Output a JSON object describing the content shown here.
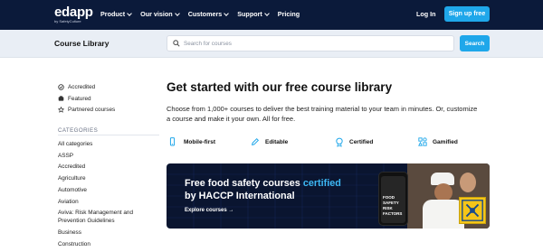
{
  "nav": {
    "logo": "edapp",
    "logo_sub": "by SafetyCulture",
    "items": [
      {
        "label": "Product",
        "dropdown": true
      },
      {
        "label": "Our vision",
        "dropdown": true
      },
      {
        "label": "Customers",
        "dropdown": true
      },
      {
        "label": "Support",
        "dropdown": true
      },
      {
        "label": "Pricing",
        "dropdown": false
      }
    ],
    "login": "Log In",
    "signup": "Sign up free"
  },
  "subbar": {
    "title": "Course Library",
    "search_placeholder": "Search for courses",
    "search_button": "Search"
  },
  "sidebar": {
    "filters": [
      {
        "label": "Accredited",
        "icon": "accredited-icon"
      },
      {
        "label": "Featured",
        "icon": "featured-icon"
      },
      {
        "label": "Partnered courses",
        "icon": "partnered-icon"
      }
    ],
    "categories_heading": "CATEGORIES",
    "categories": [
      "All categories",
      "ASSP",
      "Accredited",
      "Agriculture",
      "Automotive",
      "Aviation",
      "Aviva: Risk Management and Prevention Guidelines",
      "Business",
      "Construction"
    ]
  },
  "main": {
    "heading": "Get started with our free course library",
    "lead": "Choose from 1,000+ courses to deliver the best training material to your team in minutes. Or, customize a course and make it your own. All for free.",
    "features": [
      {
        "label": "Mobile-first",
        "icon": "mobile-icon"
      },
      {
        "label": "Editable",
        "icon": "edit-icon"
      },
      {
        "label": "Certified",
        "icon": "certified-icon"
      },
      {
        "label": "Gamified",
        "icon": "gamified-icon"
      }
    ]
  },
  "banner": {
    "title_pre": "Free food safety courses ",
    "title_accent": "certified",
    "title_post": "by HACCP International",
    "cta": "Explore courses →",
    "phone_text": "FOOD SAFETY RISK FACTORS"
  },
  "colors": {
    "nav_bg": "#0b1a3a",
    "accent": "#1fa7ea",
    "banner_bg": "#0a1530",
    "banner_accent": "#3db8f5",
    "badge": "#f5c518"
  }
}
